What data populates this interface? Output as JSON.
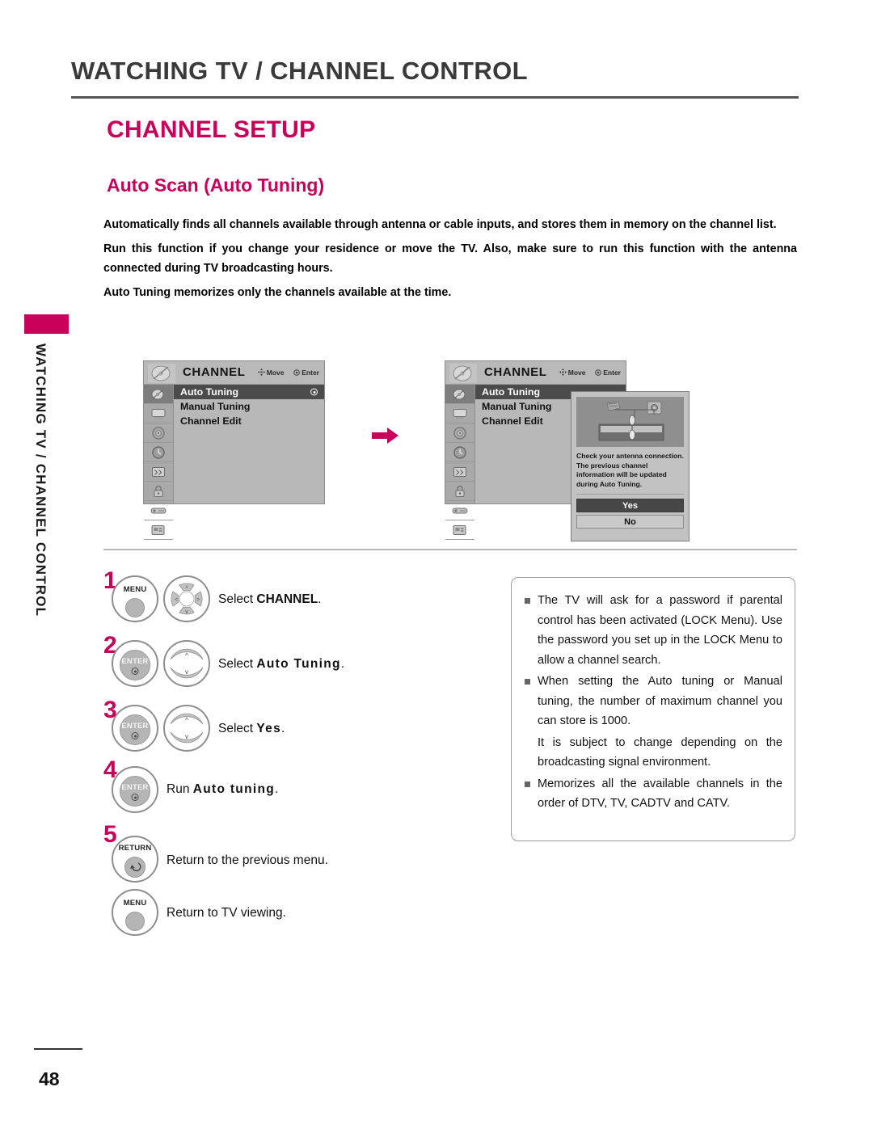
{
  "header": {
    "running_head": "WATCHING TV / CHANNEL CONTROL",
    "section_title": "CHANNEL SETUP",
    "sub_title": "Auto Scan (Auto Tuning)",
    "side_tab_text": "WATCHING TV / CHANNEL CONTROL"
  },
  "intro": {
    "p1": "Automatically finds all channels available through antenna or cable inputs, and stores them in memory on the channel list.",
    "p2": "Run this function if you change your residence or move the TV. Also, make sure to run this function with the antenna connected during TV broadcasting hours.",
    "p3": "Auto Tuning memorizes only the channels available at the time."
  },
  "osd": {
    "title": "CHANNEL",
    "hint_move": "Move",
    "hint_enter": "Enter",
    "items": [
      {
        "label": "Auto Tuning",
        "selected": true
      },
      {
        "label": "Manual Tuning",
        "selected": false
      },
      {
        "label": "Channel Edit",
        "selected": false
      }
    ],
    "rail_icons": [
      "satellite-dish-icon",
      "picture-icon",
      "audio-icon",
      "time-icon",
      "setup-icon",
      "lock-icon",
      "input-icon",
      "usb-icon"
    ]
  },
  "dialog": {
    "message": "Check your antenna connection. The previous channel information will be updated during Auto Tuning.",
    "yes_label": "Yes",
    "no_label": "No"
  },
  "flow": {
    "arrow": "right-arrow-icon"
  },
  "steps": [
    {
      "num": "1",
      "buttons": [
        {
          "type": "labeled",
          "label": "MENU",
          "name": "menu-button"
        },
        {
          "type": "dpad",
          "name": "navigation-dpad"
        }
      ],
      "text_prefix": "Select ",
      "text_bold": "CHANNEL",
      "text_suffix": ".",
      "spaced": false
    },
    {
      "num": "2",
      "buttons": [
        {
          "type": "labeled",
          "label": "ENTER",
          "name": "enter-button"
        },
        {
          "type": "updown",
          "name": "up-down-button"
        }
      ],
      "text_prefix": "Select ",
      "text_bold": "Auto Tuning",
      "text_suffix": ".",
      "spaced": true
    },
    {
      "num": "3",
      "buttons": [
        {
          "type": "labeled",
          "label": "ENTER",
          "name": "enter-button"
        },
        {
          "type": "updown",
          "name": "up-down-button"
        }
      ],
      "text_prefix": "Select ",
      "text_bold": "Yes",
      "text_suffix": ".",
      "spaced": true
    },
    {
      "num": "4",
      "buttons": [
        {
          "type": "labeled",
          "label": "ENTER",
          "name": "enter-button"
        }
      ],
      "text_prefix": "Run ",
      "text_bold": "Auto tuning",
      "text_suffix": ".",
      "spaced": true
    },
    {
      "num": "5",
      "buttons": [
        {
          "type": "return",
          "label": "RETURN",
          "name": "return-button"
        }
      ],
      "text_prefix": "Return to the previous menu.",
      "text_bold": "",
      "text_suffix": "",
      "spaced": false
    },
    {
      "num": "",
      "buttons": [
        {
          "type": "labeled",
          "label": "MENU",
          "name": "menu-button"
        }
      ],
      "text_prefix": "Return to TV viewing.",
      "text_bold": "",
      "text_suffix": "",
      "spaced": false
    }
  ],
  "notes": [
    {
      "bullet": true,
      "text": "The TV will ask for a password if parental control has been activated (LOCK Menu). Use the password you set up in the LOCK Menu to allow a channel search."
    },
    {
      "bullet": true,
      "text": "When setting the Auto tuning or Manual tuning, the number of maximum channel you can store is 1000."
    },
    {
      "bullet": false,
      "text": "It is subject to change depending on the broadcasting signal environment."
    },
    {
      "bullet": true,
      "text": "Memorizes all the available channels in the order of DTV, TV, CADTV and CATV."
    }
  ],
  "footer": {
    "page_number": "48"
  },
  "colors": {
    "accent": "#c8005a",
    "heading": "#3a3a3a",
    "osd_bg": "#b4b4b4",
    "osd_selected": "#4b4b4b"
  }
}
